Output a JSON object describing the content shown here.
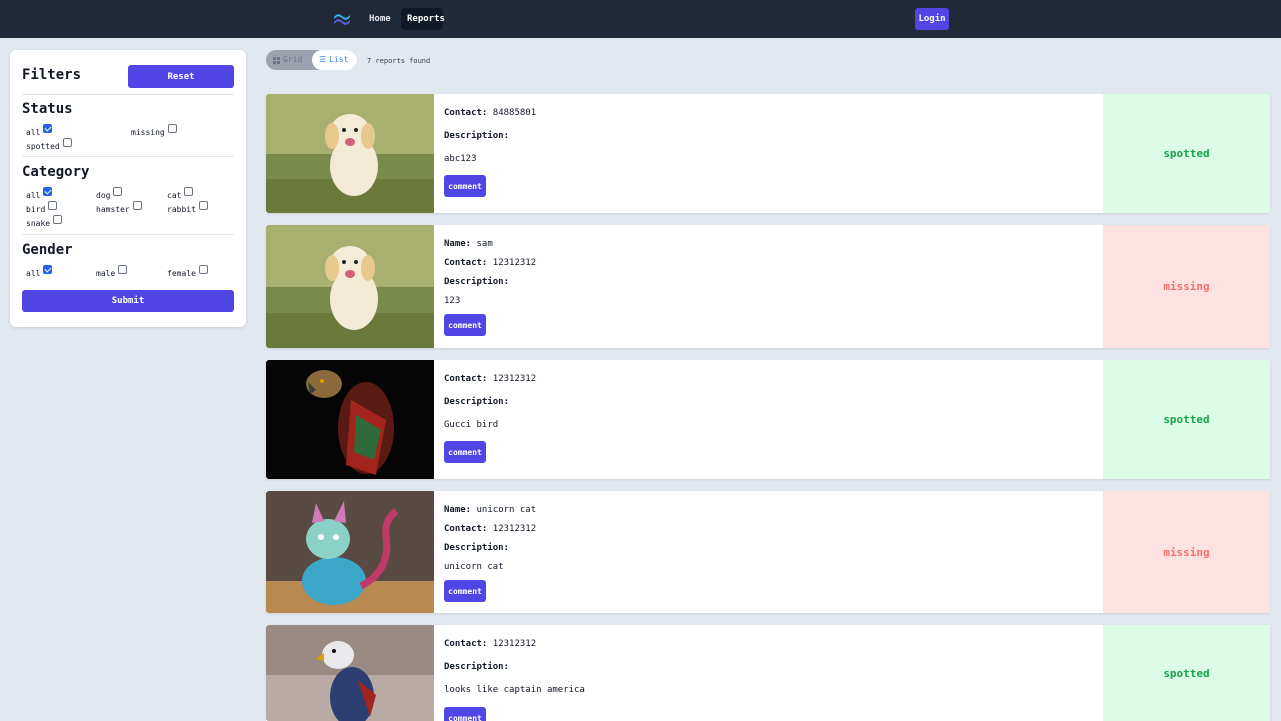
{
  "nav": {
    "home": "Home",
    "reports": "Reports",
    "login": "Login"
  },
  "filters": {
    "title": "Filters",
    "reset": "Reset",
    "submit": "Submit",
    "status": {
      "title": "Status",
      "options": [
        {
          "label": "all",
          "checked": true
        },
        {
          "label": "missing",
          "checked": false
        },
        {
          "label": "spotted",
          "checked": false
        }
      ]
    },
    "category": {
      "title": "Category",
      "options": [
        {
          "label": "all",
          "checked": true
        },
        {
          "label": "dog",
          "checked": false
        },
        {
          "label": "cat",
          "checked": false
        },
        {
          "label": "bird",
          "checked": false
        },
        {
          "label": "hamster",
          "checked": false
        },
        {
          "label": "rabbit",
          "checked": false
        },
        {
          "label": "snake",
          "checked": false
        }
      ]
    },
    "gender": {
      "title": "Gender",
      "options": [
        {
          "label": "all",
          "checked": true
        },
        {
          "label": "male",
          "checked": false
        },
        {
          "label": "female",
          "checked": false
        }
      ]
    }
  },
  "view": {
    "grid": "Grid",
    "list": "List",
    "count": "7 reports found"
  },
  "reports": [
    {
      "name": "",
      "contact": "84885801",
      "description": "abc123",
      "status": "spotted",
      "photo": "golden-puppy"
    },
    {
      "name": "sam",
      "contact": "12312312",
      "description": "123",
      "status": "missing",
      "photo": "golden-puppy"
    },
    {
      "name": "",
      "contact": "12312312",
      "description": "Gucci bird",
      "status": "spotted",
      "photo": "patterned-parrot"
    },
    {
      "name": "unicorn cat",
      "contact": "12312312",
      "description": "unicorn cat",
      "status": "missing",
      "photo": "rainbow-cat"
    },
    {
      "name": "",
      "contact": "12312312",
      "description": "looks like captain america",
      "status": "spotted",
      "photo": "armored-eagle"
    }
  ],
  "labels": {
    "name": "Name:",
    "contact": "Contact:",
    "description": "Description:",
    "comment": "comment"
  },
  "colors": {
    "navbar": "#1f2937",
    "primary": "#4f46e5",
    "spotted_bg": "#dcfce7",
    "spotted_text": "#16a34a",
    "missing_bg": "#fee2e2",
    "missing_text": "#f87171",
    "page_bg": "#e2e8f0"
  }
}
